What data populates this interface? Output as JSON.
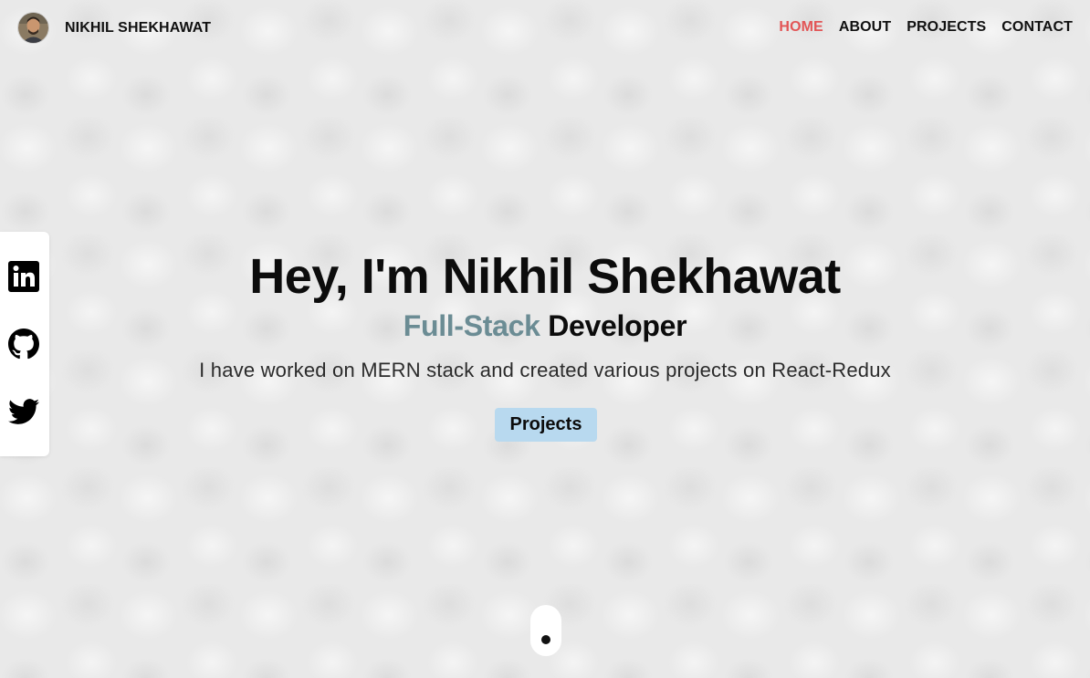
{
  "header": {
    "brand_name": "NIKHIL SHEKHAWAT",
    "nav": [
      {
        "label": "HOME",
        "active": true
      },
      {
        "label": "ABOUT",
        "active": false
      },
      {
        "label": "PROJECTS",
        "active": false
      },
      {
        "label": "CONTACT",
        "active": false
      }
    ]
  },
  "social": [
    {
      "icon": "linkedin-icon"
    },
    {
      "icon": "github-icon"
    },
    {
      "icon": "twitter-icon"
    }
  ],
  "hero": {
    "title": "Hey, I'm Nikhil Shekhawat",
    "role_accent": "Full-Stack",
    "role_rest": "Developer",
    "description": "I have worked on MERN stack and created various projects on React-Redux",
    "button_label": "Projects"
  },
  "colors": {
    "nav_active": "#e25556",
    "role_accent": "#6b8c94",
    "button_bg": "#b8d9ef",
    "page_bg": "#e9e9e9"
  }
}
